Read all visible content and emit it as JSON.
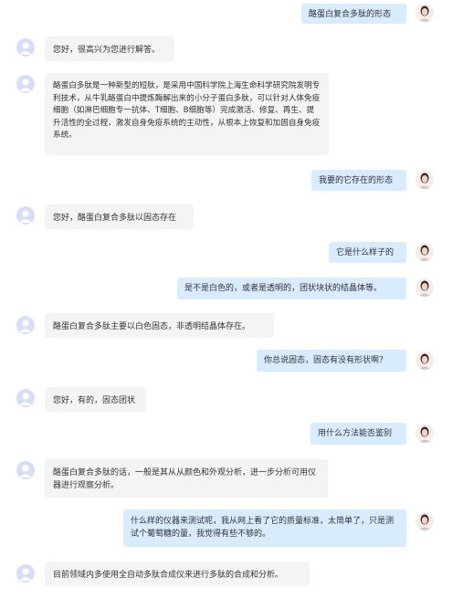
{
  "conversation": [
    {
      "role": "user",
      "text": "酪蛋白复合多肽的形态"
    },
    {
      "role": "bot",
      "text": "您好，很高兴为您进行解答。"
    },
    {
      "role": "bot",
      "text": "酪蛋白多肽是一种新型的短肽，是采用中国科学院上海生命科学研究院发明专利技术，从牛乳酪蛋白中提炼酶解出来的小分子蛋白多肽，可以针对人体免疫细胞（如淋巴细胞专一抗体、T细胞、B细胞等）完成激活、修复、再生、提升活性的全过程，激发自身免疫系统的主动性，从根本上恢复和加固自身免疫系统。"
    },
    {
      "role": "user",
      "text": "我要的它存在的形态"
    },
    {
      "role": "bot",
      "text": "您好，酪蛋白复合多肽以固态存在"
    },
    {
      "role": "user",
      "text": "它是什么样子的"
    },
    {
      "role": "user",
      "text": "是不是白色的，或者是透明的，团状块状的结晶体等。"
    },
    {
      "role": "bot",
      "text": "酪蛋白复合多肽主要以白色固态，非透明结晶体存在。"
    },
    {
      "role": "user",
      "text": "你总说固态，固态有没有形状啊？"
    },
    {
      "role": "bot",
      "text": "您好，有的，固态团状"
    },
    {
      "role": "user",
      "text": "用什么方法能否鉴别"
    },
    {
      "role": "bot",
      "text": "酪蛋白复合多肽的话，一般是其从从颜色和外观分析，进一步分析可用仪器进行观察分析。"
    },
    {
      "role": "user",
      "text": "什么样的仪器来测试呢，我从网上看了它的质量标准，太简单了，只是测试个葡萄糖的量，我觉得有些不够的。"
    },
    {
      "role": "bot",
      "text": "目前领域内多使用全自动多肽合成仪来进行多肽的合成和分析。"
    }
  ],
  "colors": {
    "user_bubble": "#d8ebff",
    "bot_bubble": "#f4f4f5",
    "bot_avatar": "#d8def6"
  },
  "icons": {
    "bot": "user-silhouette-icon",
    "user": "user-photo-avatar"
  }
}
